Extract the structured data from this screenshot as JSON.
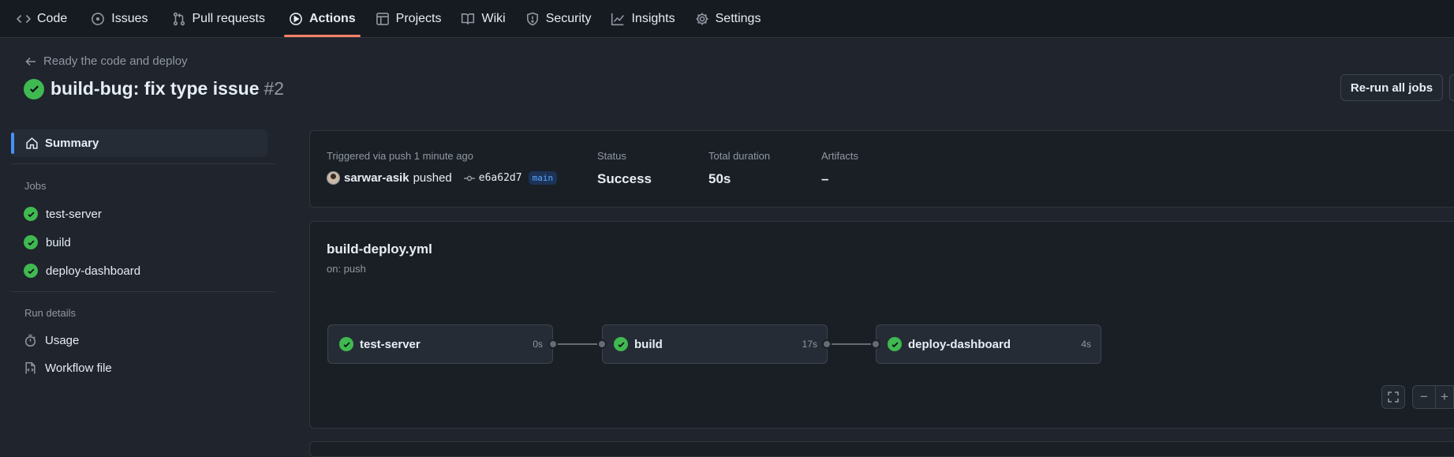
{
  "nav": {
    "tabs": [
      {
        "label": "Code",
        "icon": "code-icon"
      },
      {
        "label": "Issues",
        "icon": "issue-opened-icon"
      },
      {
        "label": "Pull requests",
        "icon": "git-pull-request-icon"
      },
      {
        "label": "Actions",
        "icon": "play-icon",
        "active": true
      },
      {
        "label": "Projects",
        "icon": "table-icon"
      },
      {
        "label": "Wiki",
        "icon": "book-icon"
      },
      {
        "label": "Security",
        "icon": "shield-icon"
      },
      {
        "label": "Insights",
        "icon": "graph-icon"
      },
      {
        "label": "Settings",
        "icon": "gear-icon"
      }
    ]
  },
  "header": {
    "back_label": "Ready the code and deploy",
    "title": "build-bug: fix type issue",
    "run_number": "#2",
    "rerun_label": "Re-run all jobs"
  },
  "sidebar": {
    "summary_label": "Summary",
    "jobs_heading": "Jobs",
    "jobs": [
      {
        "label": "test-server",
        "status": "success"
      },
      {
        "label": "build",
        "status": "success"
      },
      {
        "label": "deploy-dashboard",
        "status": "success"
      }
    ],
    "run_details_heading": "Run details",
    "usage_label": "Usage",
    "workflow_file_label": "Workflow file"
  },
  "summary": {
    "trigger_label": "Triggered via push 1 minute ago",
    "actor": "sarwar-asik",
    "action": "pushed",
    "commit": "e6a62d7",
    "branch": "main",
    "status_label": "Status",
    "status_value": "Success",
    "duration_label": "Total duration",
    "duration_value": "50s",
    "artifacts_label": "Artifacts",
    "artifacts_value": "–"
  },
  "workflow": {
    "file": "build-deploy.yml",
    "trigger": "on: push",
    "jobs": [
      {
        "name": "test-server",
        "duration": "0s"
      },
      {
        "name": "build",
        "duration": "17s"
      },
      {
        "name": "deploy-dashboard",
        "duration": "4s"
      }
    ],
    "zoom_out_symbol": "−",
    "zoom_in_symbol": "+"
  },
  "colors": {
    "success": "#3fb950",
    "active_tab_underline": "#f78166",
    "accent": "#4493f8"
  }
}
